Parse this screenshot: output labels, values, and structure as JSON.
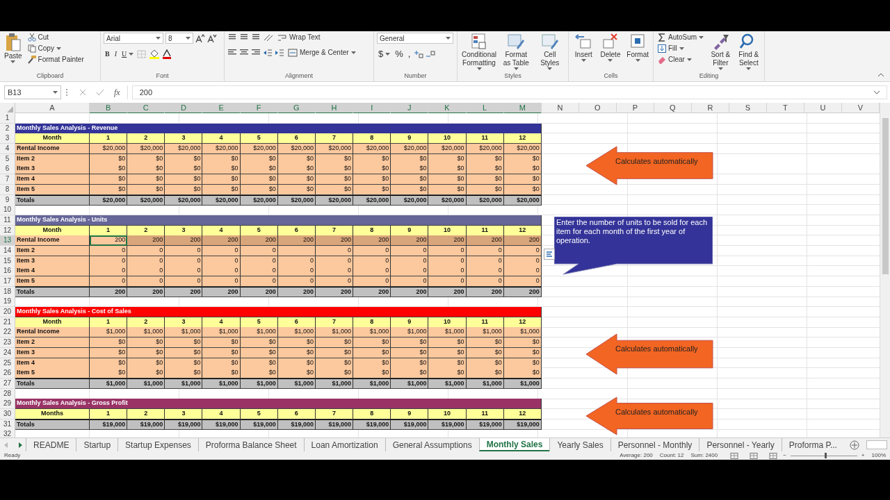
{
  "ribbon": {
    "groups": [
      {
        "label": "Clipboard",
        "kind": "clipboard",
        "big": "Paste",
        "small": [
          "Cut",
          "Copy",
          "Format Painter"
        ]
      },
      {
        "label": "Font",
        "kind": "font",
        "font": "Arial",
        "size": "8",
        "buttons": [
          "B",
          "I",
          "U"
        ]
      },
      {
        "label": "Alignment",
        "kind": "alignment",
        "small": [
          "Wrap Text",
          "Merge & Center"
        ]
      },
      {
        "label": "Number",
        "kind": "number",
        "format": "General",
        "buttons": [
          "$",
          "%",
          ","
        ]
      },
      {
        "label": "Styles",
        "kind": "big",
        "big": [
          "Conditional Formatting",
          "Format as Table",
          "Cell Styles"
        ]
      },
      {
        "label": "Cells",
        "kind": "big",
        "big": [
          "Insert",
          "Delete",
          "Format"
        ]
      },
      {
        "label": "Editing",
        "kind": "editing",
        "small": [
          "AutoSum",
          "Fill",
          "Clear"
        ],
        "big": [
          "Sort & Filter",
          "Find & Select"
        ]
      }
    ]
  },
  "formula_bar": {
    "name_box": "B13",
    "fx": "fx",
    "formula": "200"
  },
  "columns": [
    {
      "label": "A",
      "selected": false
    },
    {
      "label": "B",
      "selected": true
    },
    {
      "label": "C",
      "selected": true
    },
    {
      "label": "D",
      "selected": true
    },
    {
      "label": "E",
      "selected": true
    },
    {
      "label": "F",
      "selected": true
    },
    {
      "label": "G",
      "selected": true
    },
    {
      "label": "H",
      "selected": true
    },
    {
      "label": "I",
      "selected": true
    },
    {
      "label": "J",
      "selected": true
    },
    {
      "label": "K",
      "selected": true
    },
    {
      "label": "L",
      "selected": true
    },
    {
      "label": "M",
      "selected": true
    },
    {
      "label": "N",
      "selected": false
    },
    {
      "label": "O",
      "selected": false
    },
    {
      "label": "P",
      "selected": false
    },
    {
      "label": "Q",
      "selected": false
    },
    {
      "label": "R",
      "selected": false
    },
    {
      "label": "S",
      "selected": false
    },
    {
      "label": "T",
      "selected": false
    },
    {
      "label": "U",
      "selected": false
    },
    {
      "label": "V",
      "selected": false
    }
  ],
  "grid_rows": [
    {
      "number": "1",
      "kind": "blank",
      "selected": false
    },
    {
      "number": "2",
      "kind": "title",
      "selected": false,
      "text": "Monthly Sales Analysis - Revenue",
      "color": "#333399"
    },
    {
      "number": "3",
      "kind": "header",
      "selected": false,
      "label": "Month",
      "values": [
        "1",
        "2",
        "3",
        "4",
        "5",
        "6",
        "7",
        "8",
        "9",
        "10",
        "11",
        "12"
      ]
    },
    {
      "number": "4",
      "kind": "item",
      "selected": false,
      "label": "Rental Income",
      "values": [
        "$20,000",
        "$20,000",
        "$20,000",
        "$20,000",
        "$20,000",
        "$20,000",
        "$20,000",
        "$20,000",
        "$20,000",
        "$20,000",
        "$20,000",
        "$20,000"
      ]
    },
    {
      "number": "5",
      "kind": "item",
      "selected": false,
      "label": "Item 2",
      "values": [
        "$0",
        "$0",
        "$0",
        "$0",
        "$0",
        "$0",
        "$0",
        "$0",
        "$0",
        "$0",
        "$0",
        "$0"
      ]
    },
    {
      "number": "6",
      "kind": "item",
      "selected": false,
      "label": "Item 3",
      "values": [
        "$0",
        "$0",
        "$0",
        "$0",
        "$0",
        "$0",
        "$0",
        "$0",
        "$0",
        "$0",
        "$0",
        "$0"
      ]
    },
    {
      "number": "7",
      "kind": "item",
      "selected": false,
      "label": "Item 4",
      "values": [
        "$0",
        "$0",
        "$0",
        "$0",
        "$0",
        "$0",
        "$0",
        "$0",
        "$0",
        "$0",
        "$0",
        "$0"
      ]
    },
    {
      "number": "8",
      "kind": "item",
      "selected": false,
      "label": "Item 5",
      "values": [
        "$0",
        "$0",
        "$0",
        "$0",
        "$0",
        "$0",
        "$0",
        "$0",
        "$0",
        "$0",
        "$0",
        "$0"
      ]
    },
    {
      "number": "9",
      "kind": "totals",
      "selected": false,
      "label": "Totals",
      "values": [
        "$20,000",
        "$20,000",
        "$20,000",
        "$20,000",
        "$20,000",
        "$20,000",
        "$20,000",
        "$20,000",
        "$20,000",
        "$20,000",
        "$20,000",
        "$20,000"
      ]
    },
    {
      "number": "10",
      "kind": "blank",
      "selected": false
    },
    {
      "number": "11",
      "kind": "title",
      "selected": false,
      "text": "Monthly Sales Analysis - Units",
      "color": "#666699"
    },
    {
      "number": "12",
      "kind": "header",
      "selected": false,
      "label": "Month",
      "values": [
        "1",
        "2",
        "3",
        "4",
        "5",
        "6",
        "7",
        "8",
        "9",
        "10",
        "11",
        "12"
      ]
    },
    {
      "number": "13",
      "kind": "item",
      "selected": true,
      "label": "Rental Income",
      "values": [
        "200",
        "200",
        "200",
        "200",
        "200",
        "200",
        "200",
        "200",
        "200",
        "200",
        "200",
        "200"
      ]
    },
    {
      "number": "14",
      "kind": "item",
      "selected": false,
      "label": "Item 2",
      "values": [
        "0",
        "0",
        "0",
        "0",
        "0"
      ],
      "values_after_gap": [
        "0",
        "0",
        "0",
        "0",
        "0",
        "0"
      ]
    },
    {
      "number": "15",
      "kind": "item",
      "selected": false,
      "label": "Item 3",
      "values": [
        "0",
        "0",
        "0",
        "0",
        "0",
        "0",
        "0",
        "0",
        "0",
        "0",
        "0",
        "0"
      ]
    },
    {
      "number": "16",
      "kind": "item",
      "selected": false,
      "label": "Item 4",
      "values": [
        "0",
        "0",
        "0",
        "0",
        "0",
        "0",
        "0",
        "0",
        "0",
        "0",
        "0",
        "0"
      ]
    },
    {
      "number": "17",
      "kind": "item",
      "selected": false,
      "label": "Item 5",
      "values": [
        "0",
        "0",
        "0",
        "0",
        "0",
        "0",
        "0",
        "0",
        "0",
        "0",
        "0",
        "0"
      ]
    },
    {
      "number": "18",
      "kind": "totals",
      "selected": false,
      "label": "Totals",
      "values": [
        "200",
        "200",
        "200",
        "200",
        "200",
        "200",
        "200",
        "200",
        "200",
        "200",
        "200",
        "200"
      ]
    },
    {
      "number": "19",
      "kind": "blank",
      "selected": false
    },
    {
      "number": "20",
      "kind": "title",
      "selected": false,
      "text": "Monthly Sales Analysis - Cost of Sales",
      "color": "#ff0000"
    },
    {
      "number": "21",
      "kind": "header",
      "selected": false,
      "label": "Month",
      "values": [
        "1",
        "2",
        "3",
        "4",
        "5",
        "6",
        "7",
        "8",
        "9",
        "10",
        "11",
        "12"
      ]
    },
    {
      "number": "22",
      "kind": "item",
      "selected": false,
      "label": "Rental Income",
      "values": [
        "$1,000",
        "$1,000",
        "$1,000",
        "$1,000",
        "$1,000",
        "$1,000",
        "$1,000",
        "$1,000",
        "$1,000",
        "$1,000",
        "$1,000",
        "$1,000"
      ]
    },
    {
      "number": "23",
      "kind": "item",
      "selected": false,
      "label": "Item 2",
      "values": [
        "$0",
        "$0",
        "$0",
        "$0",
        "$0",
        "$0",
        "$0",
        "$0",
        "$0",
        "$0",
        "$0",
        "$0"
      ]
    },
    {
      "number": "24",
      "kind": "item",
      "selected": false,
      "label": "Item 3",
      "values": [
        "$0",
        "$0",
        "$0",
        "$0",
        "$0",
        "$0",
        "$0",
        "$0",
        "$0",
        "$0",
        "$0",
        "$0"
      ]
    },
    {
      "number": "25",
      "kind": "item",
      "selected": false,
      "label": "Item 4",
      "values": [
        "$0",
        "$0",
        "$0",
        "$0",
        "$0",
        "$0",
        "$0",
        "$0",
        "$0",
        "$0",
        "$0",
        "$0"
      ]
    },
    {
      "number": "26",
      "kind": "item",
      "selected": false,
      "label": "Item 5",
      "values": [
        "$0",
        "$0",
        "$0",
        "$0",
        "$0",
        "$0",
        "$0",
        "$0",
        "$0",
        "$0",
        "$0",
        "$0"
      ]
    },
    {
      "number": "27",
      "kind": "totals",
      "selected": false,
      "label": "Totals",
      "values": [
        "$1,000",
        "$1,000",
        "$1,000",
        "$1,000",
        "$1,000",
        "$1,000",
        "$1,000",
        "$1,000",
        "$1,000",
        "$1,000",
        "$1,000",
        "$1,000"
      ]
    },
    {
      "number": "28",
      "kind": "blank",
      "selected": false
    },
    {
      "number": "29",
      "kind": "title",
      "selected": false,
      "text": "Monthly Sales Analysis - Gross Profit",
      "color": "#993366"
    },
    {
      "number": "30",
      "kind": "header",
      "selected": false,
      "label": "Months",
      "values": [
        "1",
        "2",
        "3",
        "4",
        "5",
        "6",
        "7",
        "8",
        "9",
        "10",
        "11",
        "12"
      ]
    },
    {
      "number": "31",
      "kind": "totals",
      "selected": false,
      "label": "Totals",
      "values": [
        "$19,000",
        "$19,000",
        "$19,000",
        "$19,000",
        "$19,000",
        "$19,000",
        "$19,000",
        "$19,000",
        "$19,000",
        "$19,000",
        "$19,000",
        "$19,000"
      ]
    },
    {
      "number": "32",
      "kind": "blank",
      "selected": false
    }
  ],
  "callouts": [
    {
      "kind": "arrow",
      "text": "Calculates automatically"
    },
    {
      "kind": "speech",
      "text": "Enter the number of units to be sold for each item for each month of the first year of operation."
    },
    {
      "kind": "arrow",
      "text": "Calculates automatically"
    },
    {
      "kind": "arrow",
      "text": "Calculates automatically"
    }
  ],
  "sheet_tabs": [
    {
      "label": "README",
      "selected": false
    },
    {
      "label": "Startup",
      "selected": false
    },
    {
      "label": "Startup Expenses",
      "selected": false
    },
    {
      "label": "Proforma Balance Sheet",
      "selected": false
    },
    {
      "label": "Loan Amortization",
      "selected": false
    },
    {
      "label": "General Assumptions",
      "selected": false
    },
    {
      "label": "Monthly Sales",
      "selected": true
    },
    {
      "label": "Yearly Sales",
      "selected": false
    },
    {
      "label": "Personnel - Monthly",
      "selected": false
    },
    {
      "label": "Personnel - Yearly",
      "selected": false
    },
    {
      "label": "Proforma P...",
      "selected": false
    }
  ],
  "status_bar": {
    "mode": "Ready",
    "stats": [
      "Average: 200",
      "Count: 12",
      "Sum: 2400"
    ],
    "zoom": {
      "out": "−",
      "level": 0.52,
      "in": "+",
      "reading": "100%"
    }
  }
}
